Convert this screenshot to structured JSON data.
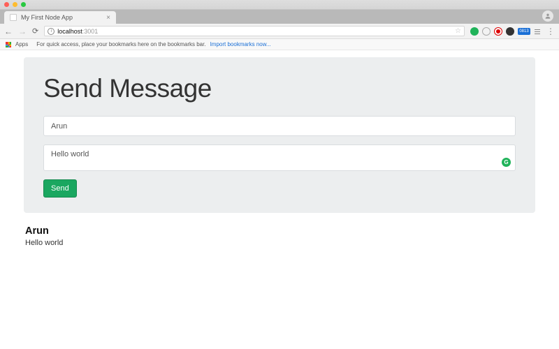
{
  "browser": {
    "tab_title": "My First Node App",
    "url_host": "localhost",
    "url_port": ":3001",
    "apps_label": "Apps",
    "bookmarks_hint": "For quick access, place your bookmarks here on the bookmarks bar.",
    "import_link": "Import bookmarks now...",
    "ext_badge": "0813"
  },
  "form": {
    "heading": "Send Message",
    "name_value": "Arun",
    "message_value": "Hello world",
    "send_label": "Send"
  },
  "messages": [
    {
      "name": "Arun",
      "body": "Hello world"
    }
  ]
}
